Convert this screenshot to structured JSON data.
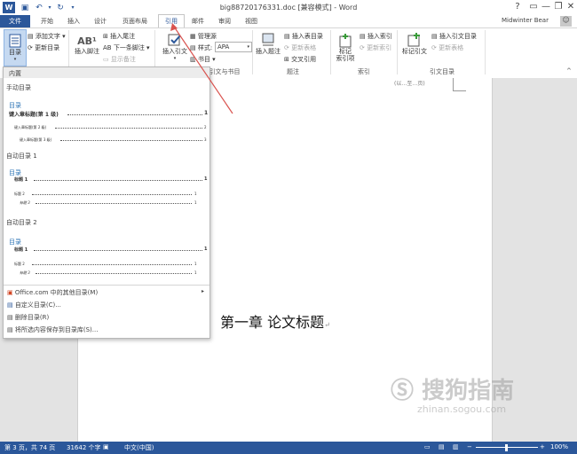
{
  "window": {
    "title": "big88720176331.doc [兼容模式] - Word",
    "user": "Midwinter Bear",
    "help": "?",
    "minimize": "—",
    "restore": "❐",
    "close": "✕"
  },
  "tabs": [
    "文件",
    "开始",
    "插入",
    "设计",
    "页面布局",
    "引用",
    "邮件",
    "审阅",
    "视图"
  ],
  "ribbon": {
    "toc": {
      "label": "目录",
      "add_text": "添加文字",
      "update_table": "更新目录"
    },
    "footnotes": {
      "insert_footnote": "插入脚注",
      "insert_endnote": "插入尾注",
      "next_footnote": "下一条脚注",
      "show_notes": "显示备注",
      "ab_icon": "AB¹"
    },
    "citations": {
      "insert_citation": "插入引文",
      "manage_sources": "管理源",
      "style_label": "样式:",
      "style_value": "APA",
      "bibliography": "书目",
      "group": "引文与书目"
    },
    "captions": {
      "insert_caption": "插入题注",
      "insert_table_of_figures": "插入表目录",
      "update_table": "更新表格",
      "cross_reference": "交叉引用",
      "group": "题注"
    },
    "index": {
      "mark_entry": "标记\n索引项",
      "insert_index": "插入索引",
      "update_index": "更新索引",
      "group": "索引"
    },
    "authorities": {
      "mark_citation": "标记引文",
      "insert_table": "插入引文目录",
      "update_table": "更新表格",
      "group": "引文目录"
    }
  },
  "toc_menu": {
    "header": "内置",
    "manual": {
      "title": "手动目录",
      "heading": "目录",
      "line1": "键入章标题(第 1 级)",
      "line2": "键入章标题(第 2 级)",
      "line3": "键入章标题(第 3 级)",
      "p1": "1",
      "p2": "2",
      "p3": "3"
    },
    "auto1": {
      "title": "自动目录 1",
      "heading": "目录",
      "line1": "标题 1",
      "line2": "标题 2",
      "line3": "标题 3",
      "p1": "1",
      "p2": "1",
      "p3": "1"
    },
    "auto2": {
      "title": "自动目录 2",
      "heading": "目录",
      "line1": "标题 1",
      "line2": "标题 2",
      "line3": "标题 3",
      "p1": "1",
      "p2": "1",
      "p3": "1"
    },
    "items": [
      {
        "label": "Office.com 中的其他目录(M)",
        "enabled": true
      },
      {
        "label": "自定义目录(C)...",
        "enabled": true
      },
      {
        "label": "删除目录(R)",
        "enabled": false
      },
      {
        "label": "将所选内容保存到目录库(S)...",
        "enabled": false
      }
    ]
  },
  "document": {
    "chapter_title": "第一章  论文标题",
    "return_mark": "↵",
    "fragment": "(以…至…页)"
  },
  "status": {
    "page": "第 3 页，共 74 页",
    "words": "31642 个字",
    "lang": "中文(中国)",
    "zoom": "100%"
  },
  "watermark": {
    "text": "搜狗指南",
    "url": "zhinan.sogou.com"
  },
  "colors": {
    "accent": "#2b579a",
    "arrow": "#d9534f"
  }
}
